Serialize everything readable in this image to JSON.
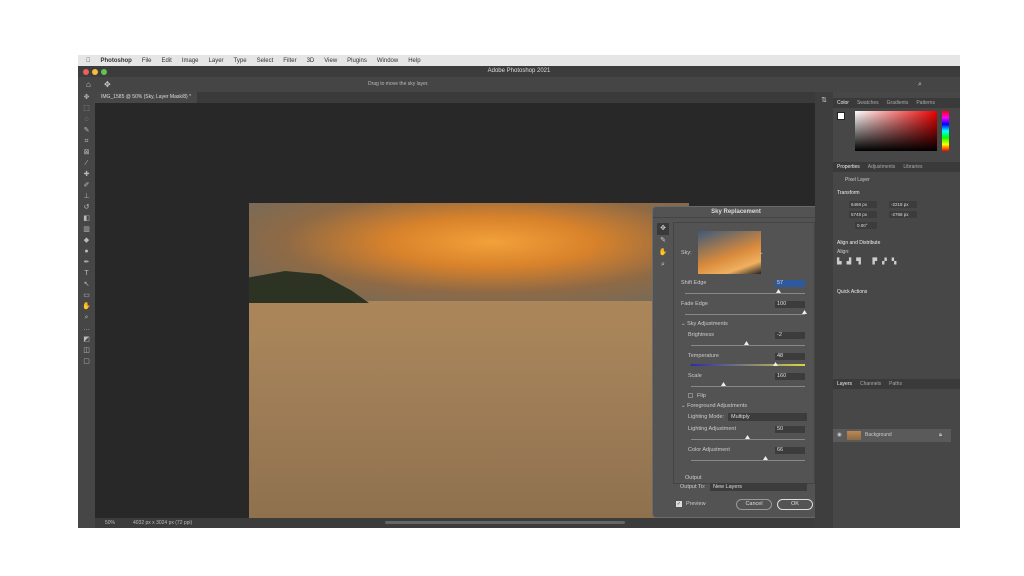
{
  "menubar": {
    "app": "Photoshop",
    "items": [
      "File",
      "Edit",
      "Image",
      "Layer",
      "Type",
      "Select",
      "Filter",
      "3D",
      "View",
      "Plugins",
      "Window",
      "Help"
    ]
  },
  "window_title": "Adobe Photoshop 2021",
  "options_hint": "Drag to move the sky layer.",
  "doc_tab": "IMG_1585 @ 50% (Sky, Layer Mask/8) *",
  "status": {
    "zoom": "50%",
    "doc_size": "4032 px x 3024 px (72 ppi)"
  },
  "dialog": {
    "title": "Sky Replacement",
    "sky_label": "Sky:",
    "shift_edge": {
      "label": "Shift Edge",
      "value": "57",
      "fraction": 0.78
    },
    "fade_edge": {
      "label": "Fade Edge",
      "value": "100",
      "fraction": 1.0
    },
    "sky_adjustments": "Sky Adjustments",
    "brightness": {
      "label": "Brightness",
      "value": "-2",
      "fraction": 0.49
    },
    "temperature": {
      "label": "Temperature",
      "value": "48",
      "fraction": 0.74
    },
    "scale": {
      "label": "Scale",
      "value": "160",
      "fraction": 0.28
    },
    "flip": "Flip",
    "foreground_adjustments": "Foreground Adjustments",
    "lighting_mode": {
      "label": "Lighting Mode:",
      "value": "Multiply"
    },
    "lighting_adjustment": {
      "label": "Lighting Adjustment",
      "value": "50",
      "fraction": 0.5
    },
    "color_adjustment": {
      "label": "Color Adjustment",
      "value": "66",
      "fraction": 0.66
    },
    "output": "Output",
    "output_to": {
      "label": "Output To:",
      "value": "New Layers"
    },
    "preview": "Preview",
    "cancel": "Cancel",
    "ok": "OK"
  },
  "panels": {
    "color_tabs": [
      "Color",
      "Swatches",
      "Gradients",
      "Patterns"
    ],
    "props_tabs": [
      "Properties",
      "Adjustments",
      "Libraries"
    ],
    "pixel_layer": "Pixel Layer",
    "transform": "Transform",
    "w": "6469 px",
    "x": "-2218 px",
    "h": "5748 px",
    "y": "-2768 px",
    "angle": "0.00°",
    "align_distribute": "Align and Distribute",
    "align": "Align:",
    "quick_actions": "Quick Actions",
    "layers_tabs": [
      "Layers",
      "Channels",
      "Paths"
    ],
    "layer_name": "Background"
  }
}
